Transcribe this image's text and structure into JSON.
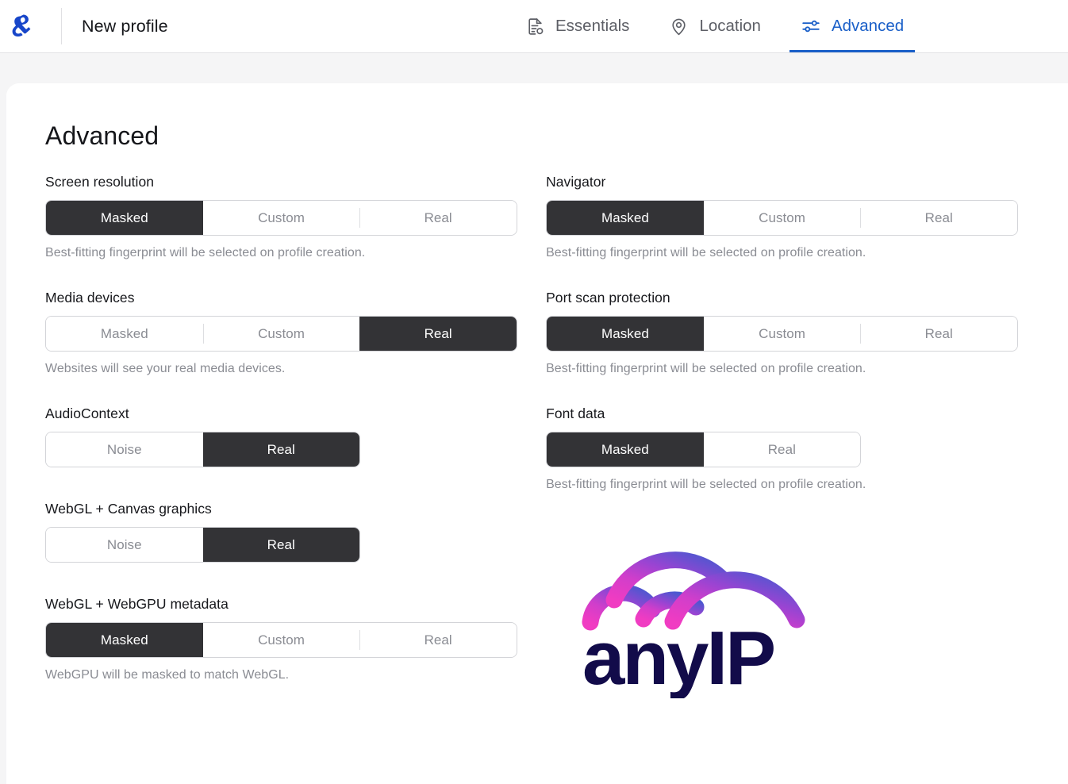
{
  "header": {
    "logo_icon": "anyip-mark-icon",
    "title": "New profile",
    "tabs": [
      {
        "label": "Essentials",
        "icon": "document-list-icon",
        "active": false
      },
      {
        "label": "Location",
        "icon": "map-pin-icon",
        "active": false
      },
      {
        "label": "Advanced",
        "icon": "sliders-icon",
        "active": true
      }
    ]
  },
  "main": {
    "title": "Advanced",
    "left_column": [
      {
        "label": "Screen resolution",
        "options": [
          "Masked",
          "Custom",
          "Real"
        ],
        "selected": "Masked",
        "description": "Best-fitting fingerprint will be selected on profile creation."
      },
      {
        "label": "Media devices",
        "options": [
          "Masked",
          "Custom",
          "Real"
        ],
        "selected": "Real",
        "description": "Websites will see your real media devices."
      },
      {
        "label": "AudioContext",
        "options": [
          "Noise",
          "Real"
        ],
        "selected": "Real",
        "description": ""
      },
      {
        "label": "WebGL + Canvas graphics",
        "options": [
          "Noise",
          "Real"
        ],
        "selected": "Real",
        "description": ""
      },
      {
        "label": "WebGL + WebGPU metadata",
        "options": [
          "Masked",
          "Custom",
          "Real"
        ],
        "selected": "Masked",
        "description": "WebGPU will be masked to match WebGL."
      }
    ],
    "right_column": [
      {
        "label": "Navigator",
        "options": [
          "Masked",
          "Custom",
          "Real"
        ],
        "selected": "Masked",
        "description": "Best-fitting fingerprint will be selected on profile creation."
      },
      {
        "label": "Port scan protection",
        "options": [
          "Masked",
          "Custom",
          "Real"
        ],
        "selected": "Masked",
        "description": "Best-fitting fingerprint will be selected on profile creation."
      },
      {
        "label": "Font data",
        "options": [
          "Masked",
          "Real"
        ],
        "selected": "Masked",
        "description": "Best-fitting fingerprint will be selected on profile creation."
      }
    ],
    "brand_logo": {
      "name": "anyip-logo",
      "wordmark": "anyIP",
      "gradient_start": "#ec3fc0",
      "gradient_mid": "#a93fd4",
      "gradient_end": "#4f55cf",
      "wordmark_color": "#120b4a"
    }
  },
  "colors": {
    "accent": "#1a5fc8",
    "selected_segment_bg": "#333336",
    "muted_text": "#8a8c93",
    "page_bg": "#f5f5f6"
  }
}
